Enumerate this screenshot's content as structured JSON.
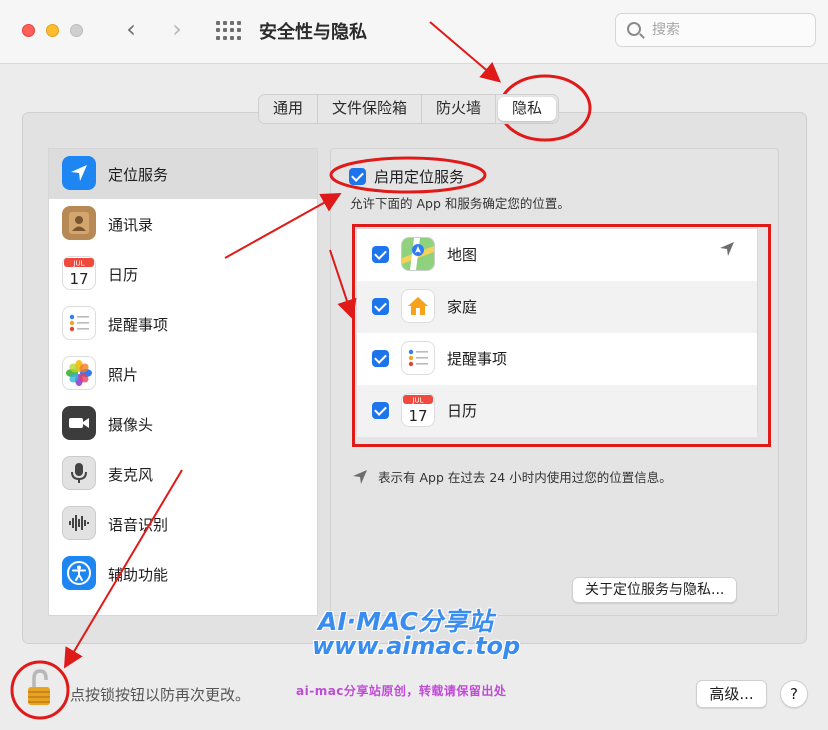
{
  "window": {
    "title": "安全性与隐私",
    "search_placeholder": "搜索"
  },
  "tabs": [
    {
      "label": "通用"
    },
    {
      "label": "文件保险箱"
    },
    {
      "label": "防火墙"
    },
    {
      "label": "隐私",
      "active": true
    }
  ],
  "sidebar": {
    "items": [
      {
        "label": "定位服务",
        "icon": "location-arrow-icon",
        "selected": true
      },
      {
        "label": "通讯录",
        "icon": "contacts-icon"
      },
      {
        "label": "日历",
        "icon": "calendar-icon"
      },
      {
        "label": "提醒事项",
        "icon": "reminders-icon"
      },
      {
        "label": "照片",
        "icon": "photos-icon"
      },
      {
        "label": "摄像头",
        "icon": "camera-icon"
      },
      {
        "label": "麦克风",
        "icon": "microphone-icon"
      },
      {
        "label": "语音识别",
        "icon": "speech-recognition-icon"
      },
      {
        "label": "辅助功能",
        "icon": "accessibility-icon"
      }
    ]
  },
  "location": {
    "enable_label": "启用定位服务",
    "enabled": true,
    "description": "允许下面的 App 和服务确定您的位置。",
    "apps": [
      {
        "name": "地图",
        "checked": true,
        "icon": "maps-icon",
        "recent_use": true
      },
      {
        "name": "家庭",
        "checked": true,
        "icon": "home-icon"
      },
      {
        "name": "提醒事项",
        "checked": true,
        "icon": "reminders-icon"
      },
      {
        "name": "日历",
        "checked": true,
        "icon": "calendar-icon"
      }
    ],
    "note": "表示有 App 在过去 24 小时内使用过您的位置信息。",
    "about_button": "关于定位服务与隐私..."
  },
  "calendar_icon": {
    "month": "JUL",
    "day": "17"
  },
  "footer": {
    "lock_text": "点按锁按钮以防再次更改。",
    "advanced_button": "高级...",
    "help_button": "?"
  },
  "watermark": {
    "line1": "AI·MAC分享站",
    "line2": "www.aimac.top",
    "line3": "ai-mac分享站原创，转载请保留出处"
  },
  "colors": {
    "accent": "#1e74ea",
    "annotation": "#e01919"
  }
}
